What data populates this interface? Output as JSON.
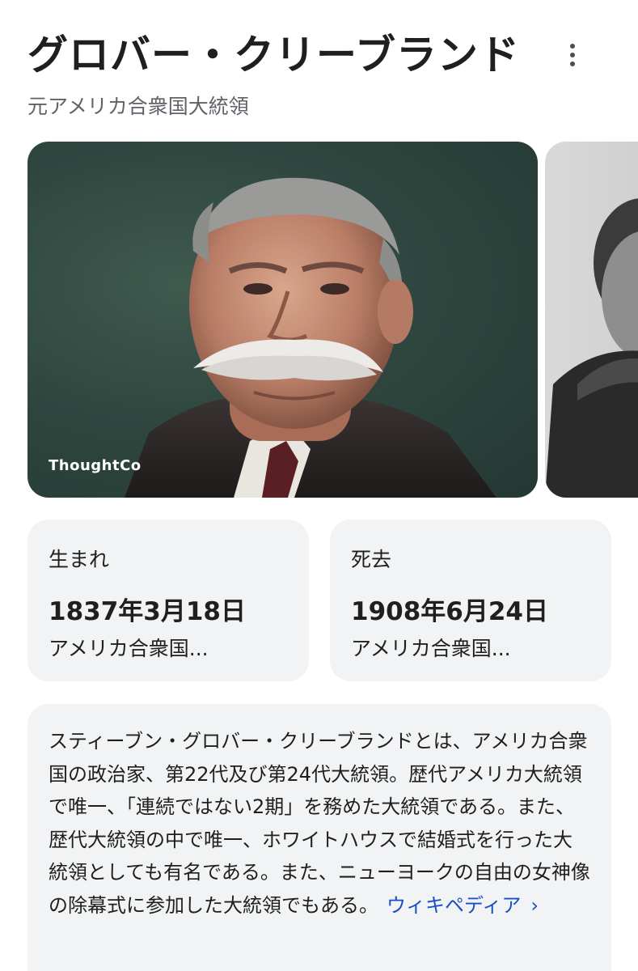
{
  "header": {
    "title": "グロバー・クリーブランド",
    "subtitle": "元アメリカ合衆国大統領"
  },
  "gallery": {
    "images": [
      {
        "source": "ThoughtCo",
        "alt": "Portrait of Grover Cleveland (colorized)"
      },
      {
        "source": "",
        "alt": "Black and white portrait"
      }
    ]
  },
  "facts": [
    {
      "label": "生まれ",
      "date": "1837年3月18日",
      "place": "アメリカ合衆国..."
    },
    {
      "label": "死去",
      "date": "1908年6月24日",
      "place": "アメリカ合衆国..."
    }
  ],
  "description": {
    "text": "スティーブン・グロバー・クリーブランドとは、アメリカ合衆国の政治家、第22代及び第24代大統領。歴代アメリカ大統領で唯一、「連続ではない2期」を務めた大統領である。また、歴代大統領の中で唯一、ホワイトハウスで結婚式を行った大統領としても有名である。また、ニューヨークの自由の女神像の除幕式に参加した大統領でもある。",
    "link_label": "ウィキペディア",
    "link_chevron": "›"
  },
  "colors": {
    "link": "#1a4fc4",
    "card_background": "#f1f3f4",
    "muted_text": "#5f6368"
  },
  "icons": {
    "menu": "more-vert-icon",
    "chevron": "chevron-right-icon"
  }
}
